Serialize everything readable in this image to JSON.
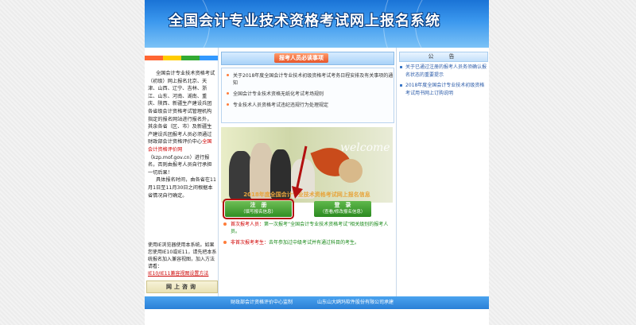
{
  "header": {
    "title": "全国会计专业技术资格考试网上报名系统"
  },
  "left": {
    "colors": [
      "#ff6633",
      "#ffcc00",
      "#33aa33",
      "#3399ff"
    ],
    "intro_part1": "全国会计专业技术资格考试（初级）网上报名北京、天津、山西、辽宁、吉林、浙江、山东、河南、湖南、重庆、陕西、新疆生产建设兵团各省级会计资格考试管理机构指定的报名网站进行报名外，其余各省（区、市）及新疆生产建设兵团报考人员必须通过财政部会计资格评价中心",
    "intro_link": "全国会计资格评价网",
    "intro_part2": "（kzp.mof.gov.cn）进行报名，否则由报考人员自行承担一切后果！",
    "time_text": "具体报名时间，由各省在11月1日至11月30日之间根据本省情况自行确定。",
    "browser_note": "使用IE浏览器使用本系统。如果您使用IE10或IE11，请先把本系统报名加入兼容视图，加入方法请看：",
    "browser_link": "IE10/IE11兼容视图设置方法",
    "online_consult": "网上咨询"
  },
  "notice": {
    "title": "报考人员必读事项",
    "items": [
      "关于2018年度全国会计专业技术初级资格考试考务日程安排及有关事项的通知",
      "全国会计专业技术资格无纸化考试考场规则",
      "专业技术人员资格考试违纪违规行为处理规定"
    ]
  },
  "welcome": {
    "word": "welcome",
    "promo": "2018年度全国会计专业技术资格考试网上报名信息"
  },
  "buttons": {
    "register_l1": "注　册",
    "register_l2": "（填写报名信息）",
    "login_l1": "登　录",
    "login_l2": "（查看/修改报名信息）"
  },
  "reglist": {
    "first_label": "首次报考人员：",
    "first_text": "第一次报考“全国会计专业技术资格考试”相关级别的报考人员。",
    "nonfirst_label": "非首次报考考生：",
    "nonfirst_text": "去年参加过中级考试并有通过科目的考生。"
  },
  "right": {
    "title": "公　告",
    "links": [
      "关于已通过注册的报考人员务须确认报名状态的重要提示",
      "2018年度全国会计专业技术初级资格考试用书网上订购说明"
    ]
  },
  "footer": {
    "sponsor": "财政部会计资格评价中心监制",
    "developer": "山东山大鸥玛软件股份有限公司承建"
  }
}
